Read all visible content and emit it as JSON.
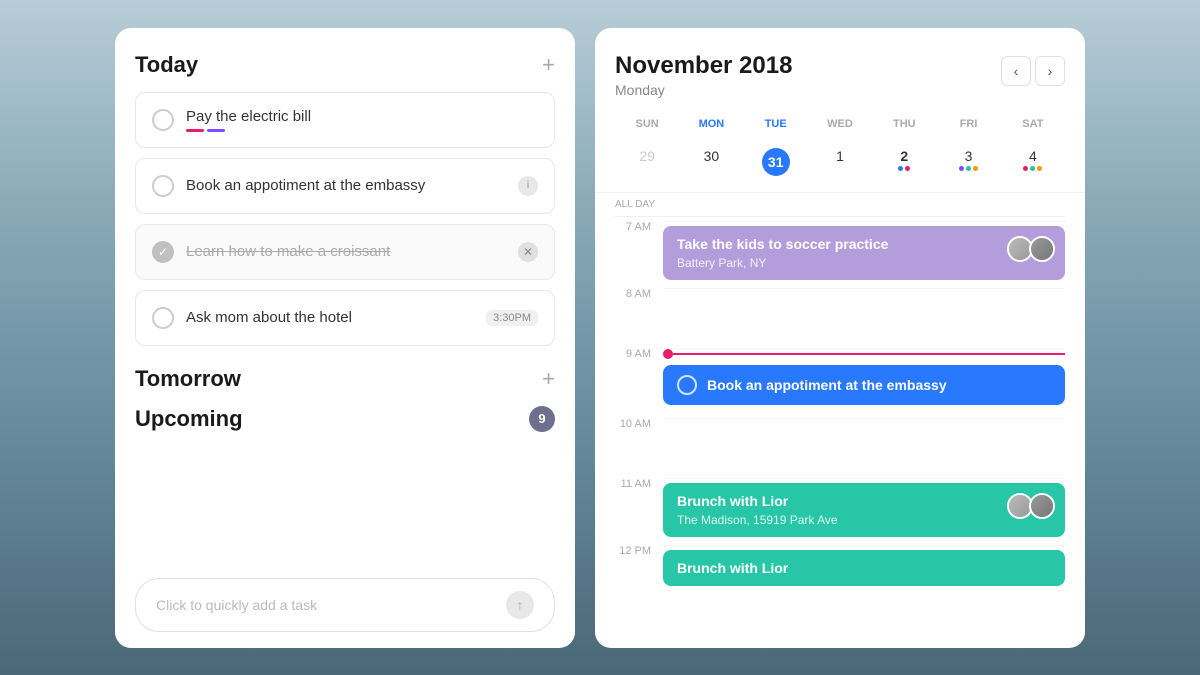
{
  "left": {
    "today_label": "Today",
    "tomorrow_label": "Tomorrow",
    "upcoming_label": "Upcoming",
    "upcoming_count": "9",
    "add_icon": "+",
    "tasks": [
      {
        "id": "task1",
        "text": "Pay the electric bill",
        "completed": false,
        "has_tag": false,
        "has_time": false,
        "dots": [
          {
            "color": "#e91e63"
          },
          {
            "color": "#7c4dff"
          }
        ]
      },
      {
        "id": "task2",
        "text": "Book an appotiment at the embassy",
        "completed": false,
        "has_tag": true,
        "tag_text": "i",
        "has_time": false,
        "dots": []
      },
      {
        "id": "task3",
        "text": "Learn how to make a croissant",
        "completed": true,
        "has_tag": false,
        "has_time": false,
        "dots": []
      },
      {
        "id": "task4",
        "text": "Ask mom about the hotel",
        "completed": false,
        "has_tag": false,
        "has_time": true,
        "time": "3:30PM",
        "dots": []
      }
    ],
    "quick_add_placeholder": "Click to quickly add a task"
  },
  "right": {
    "month_year": "November 2018",
    "day_name": "Monday",
    "nav_prev": "‹",
    "nav_next": "›",
    "day_headers": [
      "SUN",
      "MON",
      "TUE",
      "WED",
      "THU",
      "FRI",
      "SAT"
    ],
    "dates": [
      {
        "num": "29",
        "muted": true,
        "today": false,
        "bold": false,
        "dots": []
      },
      {
        "num": "30",
        "muted": false,
        "today": false,
        "bold": false,
        "dots": []
      },
      {
        "num": "31",
        "muted": false,
        "today": true,
        "bold": false,
        "dots": []
      },
      {
        "num": "1",
        "muted": false,
        "today": false,
        "bold": false,
        "dots": []
      },
      {
        "num": "2",
        "muted": false,
        "today": false,
        "bold": true,
        "dots": [
          {
            "color": "#2979ff"
          },
          {
            "color": "#e91e63"
          }
        ]
      },
      {
        "num": "3",
        "muted": false,
        "today": false,
        "bold": false,
        "dots": [
          {
            "color": "#7c4dff"
          },
          {
            "color": "#26c6a6"
          },
          {
            "color": "#ff9800"
          }
        ]
      },
      {
        "num": "4",
        "muted": false,
        "today": false,
        "bold": false,
        "dots": [
          {
            "color": "#e91e63"
          },
          {
            "color": "#26c6a6"
          },
          {
            "color": "#ff9800"
          }
        ]
      }
    ],
    "all_day_label": "ALL DAY",
    "time_slots": [
      {
        "label": "7 AM",
        "event": {
          "type": "purple",
          "title": "Take the kids to soccer practice",
          "location": "Battery Park, NY",
          "has_avatars": true
        }
      },
      {
        "label": "8 AM",
        "event": null
      },
      {
        "label": "9 AM",
        "event": {
          "type": "blue",
          "title": "Book an appotiment at the embassy",
          "location": null,
          "has_avatars": false
        },
        "has_now_line": true
      },
      {
        "label": "10 AM",
        "event": null
      },
      {
        "label": "11 AM",
        "event": {
          "type": "teal",
          "title": "Brunch with Lior",
          "location": "The Madison, 15919 Park Ave",
          "has_avatars": true
        }
      },
      {
        "label": "12 PM",
        "event": {
          "type": "teal",
          "title": "Brunch with Lior",
          "location": null,
          "has_avatars": false
        }
      }
    ]
  }
}
